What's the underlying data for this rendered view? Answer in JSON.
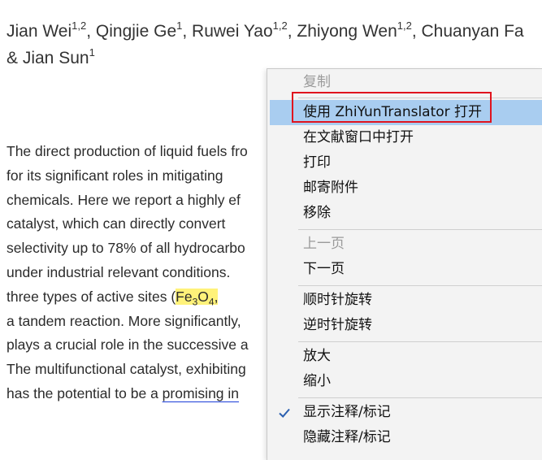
{
  "document": {
    "authors_line1": [
      {
        "name": "Jian Wei",
        "sup": "1,2",
        "sep": ", "
      },
      {
        "name": "Qingjie Ge",
        "sup": "1",
        "sep": ", "
      },
      {
        "name": "Ruwei Yao",
        "sup": "1,2",
        "sep": ", "
      },
      {
        "name": "Zhiyong Wen",
        "sup": "1,2",
        "sep": ", "
      },
      {
        "name": "Chuanyan Fa",
        "sup": "",
        "sep": ""
      }
    ],
    "authors_line2_prefix": "& Jian Sun",
    "authors_line2_sup": "1",
    "abstract_lines": [
      "The direct production of liquid fuels fro",
      "for its significant roles in mitigating",
      "chemicals. Here we report a highly ef",
      "catalyst, which can directly convert",
      "selectivity up to 78% of all hydrocarbo",
      "under industrial relevant conditions.",
      "",
      "a tandem reaction. More significantly,",
      "plays a crucial role in the successive a",
      "The multifunctional catalyst, exhibiting",
      ""
    ],
    "line7_prefix": "three types of active sites (",
    "line7_hl_fe": "Fe",
    "line7_hl_sub3": "3",
    "line7_hl_o": "O",
    "line7_hl_sub4": "4",
    "line7_hl_tail": ",",
    "line11_prefix": "has the potential to be a ",
    "line11_link": "promising in"
  },
  "context_menu": {
    "items": [
      {
        "label": "复制",
        "disabled": true
      },
      {
        "label": "使用 ZhiYunTranslator 打开",
        "highlighted": true
      },
      {
        "label": "在文献窗口中打开"
      },
      {
        "label": "打印"
      },
      {
        "label": "邮寄附件"
      },
      {
        "label": "移除"
      },
      {
        "label": "上一页",
        "disabled": true
      },
      {
        "label": "下一页"
      },
      {
        "label": "顺时针旋转"
      },
      {
        "label": "逆时针旋转"
      },
      {
        "label": "放大"
      },
      {
        "label": "缩小"
      },
      {
        "label": "显示注释/标记",
        "checked": true
      },
      {
        "label": "隐藏注释/标记"
      }
    ]
  },
  "colors": {
    "menu_highlight": "#a9cdf0",
    "annotation_box": "#e0141e",
    "text_highlight": "#fff27a",
    "link_underline": "#1a3cd8"
  },
  "icons": {
    "checkmark": "check-icon"
  }
}
